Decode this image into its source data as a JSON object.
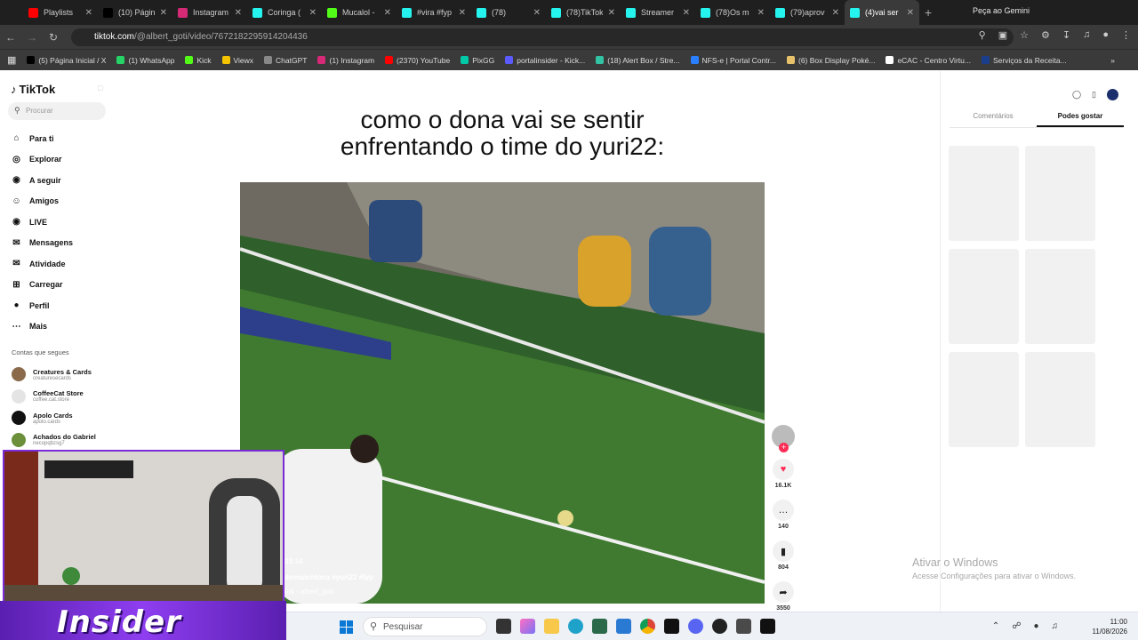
{
  "tabs": [
    {
      "title": "Playlists",
      "color": "#ff0000"
    },
    {
      "title": "(10) Página",
      "color": "#000000"
    },
    {
      "title": "Instagram",
      "color": "#d62976"
    },
    {
      "title": "Coringa (",
      "color": "#25f4ee"
    },
    {
      "title": "Mucalol -",
      "color": "#53fc18"
    },
    {
      "title": "#vira #fyp",
      "color": "#25f4ee"
    },
    {
      "title": "(78)",
      "color": "#25f4ee"
    },
    {
      "title": "(78)TikTok",
      "color": "#25f4ee"
    },
    {
      "title": "Streamer",
      "color": "#25f4ee"
    },
    {
      "title": "(78)Os m",
      "color": "#25f4ee"
    },
    {
      "title": "(79)aprov",
      "color": "#25f4ee"
    },
    {
      "title": "(4)vai ser",
      "color": "#25f4ee"
    }
  ],
  "gemini": "Peça ao Gemini",
  "url": {
    "domain": "tiktok.com",
    "path": "/@albert_goti/video/7672182295914204436"
  },
  "bookmarks": [
    {
      "label": "(5) Página Inicial / X",
      "color": "#000000"
    },
    {
      "label": "(1) WhatsApp",
      "color": "#25d366"
    },
    {
      "label": "Kick",
      "color": "#53fc18"
    },
    {
      "label": "Viewx",
      "color": "#f5c400"
    },
    {
      "label": "ChatGPT",
      "color": "#888888"
    },
    {
      "label": "(1) Instagram",
      "color": "#d62976"
    },
    {
      "label": "(2370) YouTube",
      "color": "#ff0000"
    },
    {
      "label": "PixGG",
      "color": "#00c9a7"
    },
    {
      "label": "portalinsider - Kick...",
      "color": "#5a5aff"
    },
    {
      "label": "(18) Alert Box / Stre...",
      "color": "#31c3a2"
    },
    {
      "label": "NFS-e | Portal Contr...",
      "color": "#2a7fff"
    },
    {
      "label": "(6) Box Display Poké...",
      "color": "#e8c26a"
    },
    {
      "label": "eCAC - Centro Virtu...",
      "color": "#ffffff"
    },
    {
      "label": "Serviços da Receita...",
      "color": "#1a3e8c"
    }
  ],
  "sidebar": {
    "brand": "TikTok",
    "search_placeholder": "Procurar",
    "menu": [
      {
        "label": "Para ti",
        "icon": "home-icon"
      },
      {
        "label": "Explorar",
        "icon": "compass-icon"
      },
      {
        "label": "A seguir",
        "icon": "following-icon"
      },
      {
        "label": "Amigos",
        "icon": "friends-icon"
      },
      {
        "label": "LIVE",
        "icon": "live-icon"
      },
      {
        "label": "Mensagens",
        "icon": "messages-icon"
      },
      {
        "label": "Atividade",
        "icon": "activity-icon"
      },
      {
        "label": "Carregar",
        "icon": "upload-icon"
      },
      {
        "label": "Perfil",
        "icon": "profile-icon"
      },
      {
        "label": "Mais",
        "icon": "more-icon"
      }
    ],
    "follows_title": "Contas que segues",
    "follows": [
      {
        "name": "Creatures & Cards",
        "user": "creaturesecards",
        "color": "#8a6a4a"
      },
      {
        "name": "CoffeeCat Store",
        "user": "coffee.cat.store",
        "color": "#e4e4e4"
      },
      {
        "name": "Apolo Cards",
        "user": "apolo.cards",
        "color": "#111111"
      },
      {
        "name": "Achados do Gabriel",
        "user": "necopqbzsg7",
        "color": "#6b8f3a"
      }
    ]
  },
  "video": {
    "caption": "como o dona vai se sentir\nenfrentando o time do yuri22:",
    "tags": "demais#dona #yuri22 #fyp",
    "author": "nal - albert_goti",
    "timestamp": "03:14"
  },
  "actions": {
    "likes": "16.1K",
    "comments": "140",
    "saves": "804",
    "shares": "3550"
  },
  "right_panel": {
    "tab_comments": "Comentários",
    "tab_suggested": "Podes gostar"
  },
  "watermark": {
    "line1": "Ativar o Windows",
    "line2": "Acesse Configurações para ativar o Windows."
  },
  "overlay_logo": "Insider",
  "taskbar": {
    "search": "Pesquisar",
    "time": "11:00",
    "date": "11/08/2026"
  }
}
